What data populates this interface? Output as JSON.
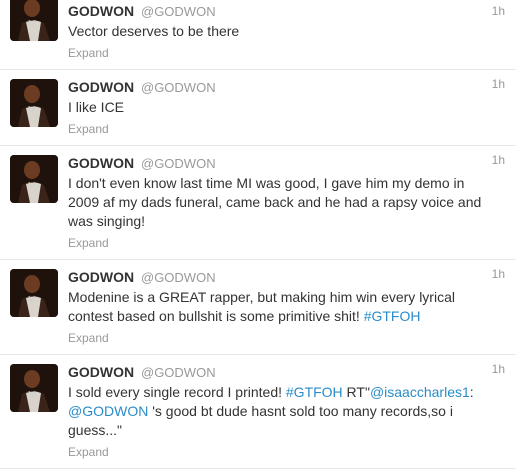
{
  "tweets": [
    {
      "name": "GODWON",
      "handle": "@GODWON",
      "time": "1h",
      "text": [
        "Vector deserves to be there"
      ],
      "expand": "Expand"
    },
    {
      "name": "GODWON",
      "handle": "@GODWON",
      "time": "1h",
      "text": [
        "I like ICE"
      ],
      "expand": "Expand"
    },
    {
      "name": "GODWON",
      "handle": "@GODWON",
      "time": "1h",
      "text": [
        "I don't even know last time MI was good, I gave him my demo in 2009 af my dads funeral, came back and he had a rapsy voice and was singing!"
      ],
      "expand": "Expand"
    },
    {
      "name": "GODWON",
      "handle": "@GODWON",
      "time": "1h",
      "text": [
        "Modenine is a GREAT rapper, but making him win every lyrical contest based on bullshit is some primitive shit! ",
        "#GTFOH"
      ],
      "expand": "Expand"
    },
    {
      "name": "GODWON",
      "handle": "@GODWON",
      "time": "1h",
      "text": [
        "I sold every single record I printed! ",
        "#GTFOH",
        " RT\"",
        "@isaaccharles1",
        ": ",
        "@GODWON",
        " 's good bt dude hasnt sold too many records,so i guess...\""
      ],
      "expand": "Expand"
    }
  ],
  "colors": {
    "link": "#2a8cc9",
    "muted": "#999999",
    "text": "#333333",
    "divider": "#e8e8e8"
  },
  "icons": {
    "avatar": "user-avatar-photo"
  }
}
